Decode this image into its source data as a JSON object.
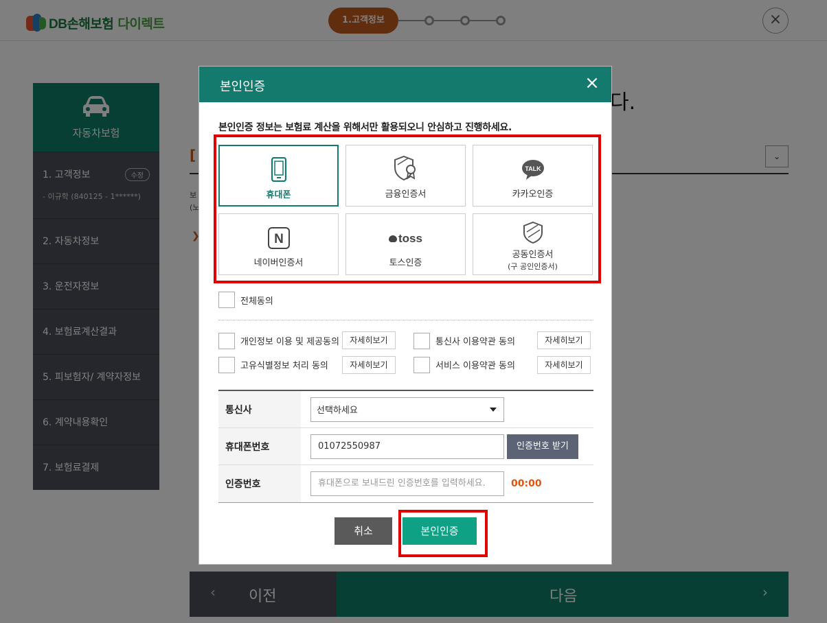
{
  "header": {
    "logo_db": "DB손해보험",
    "logo_direct": "다이렉트",
    "step_active": "1.고객정보"
  },
  "sidebar": {
    "title": "자동차보험",
    "items": [
      {
        "label": "1. 고객정보",
        "badge": "수정",
        "sub": "- 이규학 (840125 - 1******)"
      },
      {
        "label": "2. 자동차정보"
      },
      {
        "label": "3. 운전자정보"
      },
      {
        "label": "4. 보험료계산결과"
      },
      {
        "label": "5. 피보험자/ 계약자정보"
      },
      {
        "label": "6. 계약내용확인"
      },
      {
        "label": "7. 보험료결제"
      }
    ]
  },
  "background": {
    "title_tail": "다.",
    "bar_mark": "[",
    "small_line1": "보",
    "small_line2": "(노",
    "arrow": "❯"
  },
  "bottom": {
    "prev_label": "이전",
    "next_label": "다음"
  },
  "modal": {
    "title": "본인인증",
    "notice": "본인인증 정보는 보험료 계산을 위해서만 활용되오니 안심하고 진행하세요.",
    "methods": [
      {
        "label": "휴대폰",
        "icon": "phone-icon",
        "selected": true
      },
      {
        "label": "금융인증서",
        "icon": "certificate-shield-icon"
      },
      {
        "label": "카카오인증",
        "icon": "kakao-talk-icon",
        "icon_text": "TALK"
      },
      {
        "label": "네이버인증서",
        "icon": "naver-icon",
        "icon_text": "N"
      },
      {
        "label": "토스인증",
        "icon": "toss-icon",
        "icon_text": "toss"
      },
      {
        "label": "공동인증서",
        "sub": "(구 공인인증서)",
        "icon": "shield-icon"
      }
    ],
    "agree_all": "전체동의",
    "agreements": [
      {
        "label": "개인정보 이용 및 제공동의",
        "detail": "자세히보기"
      },
      {
        "label": "통신사 이용약관 동의",
        "detail": "자세히보기"
      },
      {
        "label": "고유식별정보 처리 동의",
        "detail": "자세히보기"
      },
      {
        "label": "서비스 이용약관 동의",
        "detail": "자세히보기"
      }
    ],
    "form": {
      "carrier_label": "통신사",
      "carrier_value": "선택하세요",
      "phone_label": "휴대폰번호",
      "phone_value": "01072550987",
      "request_code": "인증번호 받기",
      "code_label": "인증번호",
      "code_placeholder": "휴대폰으로 보내드린 인증번호를 입력하세요.",
      "timer": "00:00"
    },
    "cancel": "취소",
    "confirm": "본인인증"
  },
  "colors": {
    "brand_green": "#147a6e",
    "highlight_red": "#e00000",
    "confirm_green": "#0fa184",
    "step_orange": "#c15a1c",
    "timer_orange": "#e0550d"
  }
}
